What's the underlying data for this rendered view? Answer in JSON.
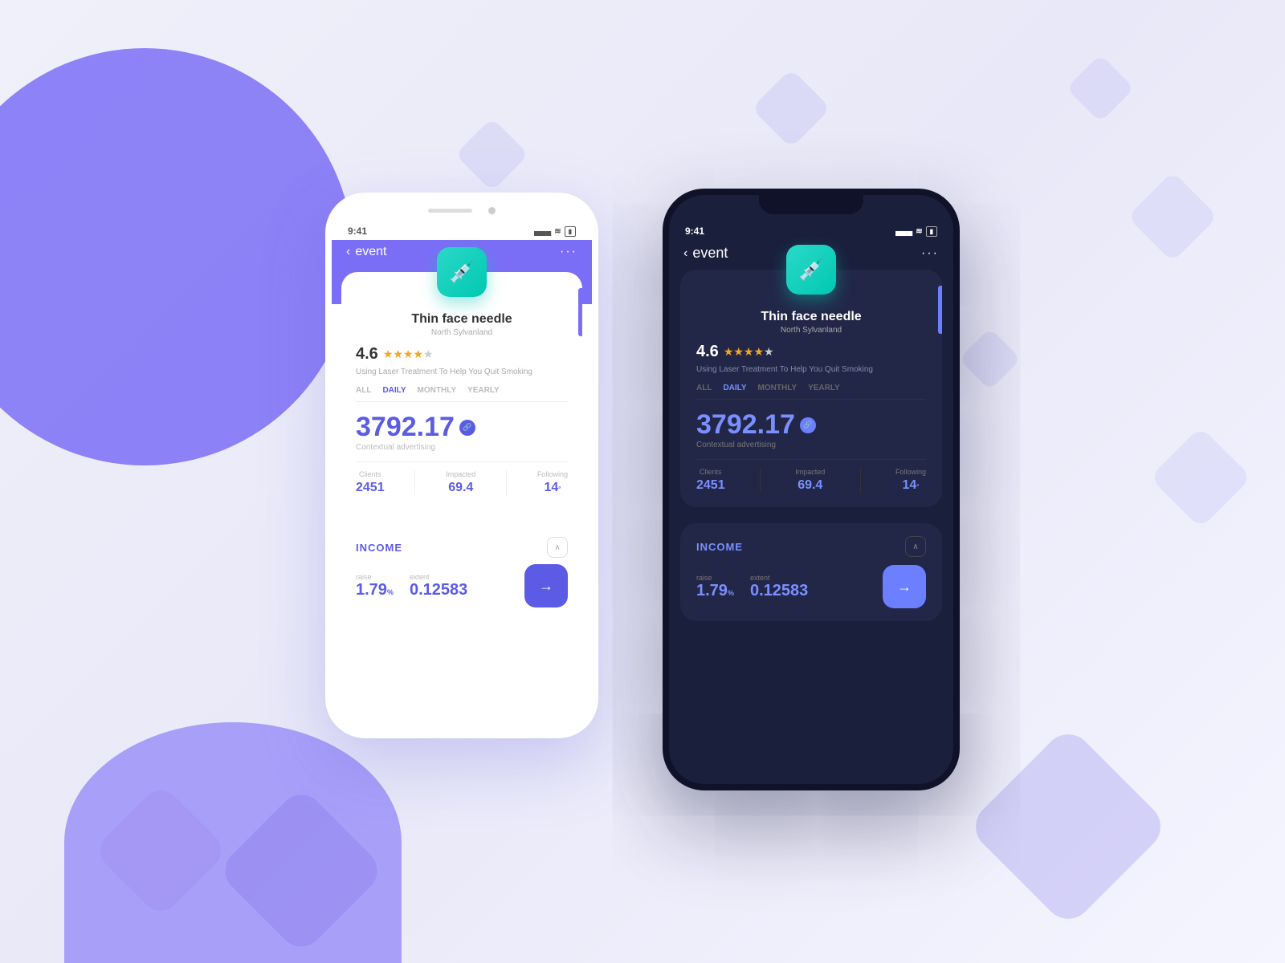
{
  "background": {
    "blob_left_color": "#7B6EF6",
    "blob_right_color": "#9B8FF8"
  },
  "phone_light": {
    "status_bar": {
      "time": "9:41",
      "signal": "▲▲▲",
      "wifi": "wifi",
      "battery": "battery"
    },
    "nav": {
      "back_label": "event",
      "dots": "···"
    },
    "card": {
      "icon": "💉",
      "title": "Thin face needle",
      "subtitle": "North Sylvanland",
      "rating": "4.6",
      "description": "Using Laser Treatment To Help You Quit Smoking",
      "tabs": [
        "ALL",
        "DAILY",
        "MONTHLY",
        "YEARLY"
      ],
      "active_tab": "DAILY",
      "big_number": "3792.17",
      "contextual_label": "Contextual advertising",
      "stats": [
        {
          "label": "Clients",
          "value": "2451",
          "sup": ""
        },
        {
          "label": "Impacted",
          "value": "69.4",
          "sup": ""
        },
        {
          "label": "Following",
          "value": "14",
          "sup": "°"
        }
      ]
    },
    "income": {
      "title": "INCOME",
      "raise_label": "raise",
      "raise_value": "1.79",
      "raise_sup": "%",
      "extent_label": "extent",
      "extent_value": "0.12583",
      "arrow": "→"
    }
  },
  "phone_dark": {
    "status_bar": {
      "time": "9:41",
      "signal": "▲▲▲",
      "wifi": "wifi",
      "battery": "battery"
    },
    "nav": {
      "back_label": "event",
      "dots": "···"
    },
    "card": {
      "icon": "💉",
      "title": "Thin face needle",
      "subtitle": "North Sylvanland",
      "rating": "4.6",
      "description": "Using Laser Treatment To Help You Quit Smoking",
      "tabs": [
        "ALL",
        "DAILY",
        "MONTHLY",
        "YEARLY"
      ],
      "active_tab": "DAILY",
      "big_number": "3792.17",
      "contextual_label": "Contextual advertising",
      "stats": [
        {
          "label": "Clients",
          "value": "2451",
          "sup": ""
        },
        {
          "label": "Impacted",
          "value": "69.4",
          "sup": ""
        },
        {
          "label": "Following",
          "value": "14",
          "sup": "°"
        }
      ]
    },
    "income": {
      "title": "INCOME",
      "raise_label": "raise",
      "raise_value": "1.79",
      "raise_sup": "%",
      "extent_label": "extent",
      "extent_value": "0.12583",
      "arrow": "→"
    }
  }
}
